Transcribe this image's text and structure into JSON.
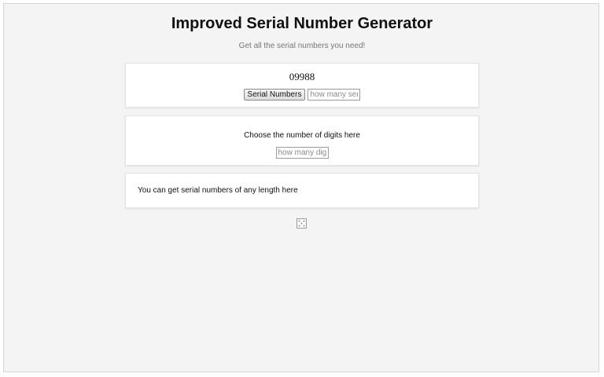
{
  "header": {
    "title": "Improved Serial Number Generator",
    "subtitle": "Get all the serial numbers you need!"
  },
  "generator": {
    "serial_value": "09988",
    "button_label": "Serial Numbers",
    "count_placeholder": "how many serial numbers"
  },
  "digits": {
    "label": "Choose the number of digits here",
    "placeholder": "how many digits"
  },
  "info": {
    "text": "You can get serial numbers of any length here"
  },
  "footer": {
    "icon": "dice-icon"
  }
}
